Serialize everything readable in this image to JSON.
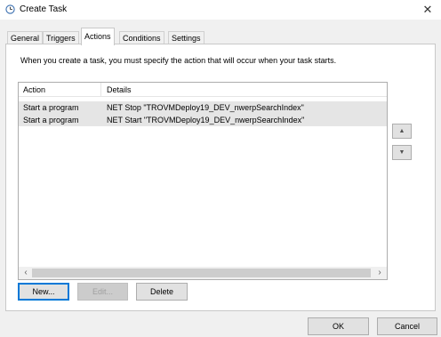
{
  "window": {
    "title": "Create Task"
  },
  "tabs": [
    {
      "label": "General"
    },
    {
      "label": "Triggers"
    },
    {
      "label": "Actions"
    },
    {
      "label": "Conditions"
    },
    {
      "label": "Settings"
    }
  ],
  "active_tab": "Actions",
  "instruction": "When you create a task, you must specify the action that will occur when your task starts.",
  "actions_list": {
    "columns": [
      "Action",
      "Details"
    ],
    "rows": [
      [
        "Start a program",
        "NET Stop \"TROVMDeploy19_DEV_nwerpSearchIndex\""
      ],
      [
        "Start a program",
        "NET Start \"TROVMDeploy19_DEV_nwerpSearchIndex\""
      ]
    ]
  },
  "buttons": {
    "new": "New...",
    "edit": "Edit...",
    "delete": "Delete",
    "ok": "OK",
    "cancel": "Cancel"
  },
  "icons": {
    "title": "clock-icon",
    "close": "close-icon",
    "move_up": "chevron-up-icon",
    "move_down": "chevron-down-icon",
    "scroll_left": "chevron-left-icon",
    "scroll_right": "chevron-right-icon"
  }
}
